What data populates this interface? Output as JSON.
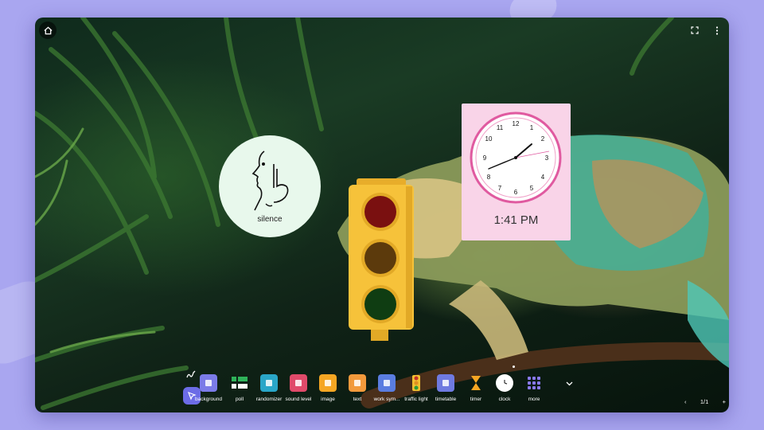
{
  "board": {
    "home_icon": "home-icon",
    "fullscreen_icon": "fullscreen-icon",
    "menu_icon": "more-vertical-icon"
  },
  "widgets": {
    "silence": {
      "label": "silence",
      "icon": "shush-face-icon"
    },
    "traffic_light": {
      "colors": [
        "#7a1010",
        "#5c3a0c",
        "#0f3d12"
      ],
      "housing": "#f6c23a"
    },
    "clock": {
      "time_text": "1:41 PM",
      "face_color": "#e05aa0",
      "card_color": "#f9d4e8"
    }
  },
  "toolbar": {
    "pointer_icon": "pointer-icon",
    "pen_icon": "pen-icon",
    "tools": [
      {
        "label": "background",
        "icon": "background-icon",
        "color": "#7b7be8"
      },
      {
        "label": "poll",
        "icon": "poll-icon",
        "color": "#2fb35a"
      },
      {
        "label": "randomizer",
        "icon": "randomizer-icon",
        "color": "#2aa6c8"
      },
      {
        "label": "sound level",
        "icon": "sound-level-icon",
        "color": "#e04a6a"
      },
      {
        "label": "image",
        "icon": "image-icon",
        "color": "#f5a623"
      },
      {
        "label": "text",
        "icon": "text-icon",
        "color": "#f29a3c"
      },
      {
        "label": "work sym...",
        "icon": "work-symbols-icon",
        "color": "#5a7de0"
      },
      {
        "label": "traffic light",
        "icon": "traffic-light-icon",
        "color": "#f0c030"
      },
      {
        "label": "timetable",
        "icon": "timetable-icon",
        "color": "#6f7ae0"
      },
      {
        "label": "timer",
        "icon": "timer-icon",
        "color": "#f5a623"
      },
      {
        "label": "clock",
        "icon": "clock-icon",
        "color": "#ffffff"
      },
      {
        "label": "more",
        "icon": "more-grid-icon",
        "color": "#8a7af0"
      }
    ],
    "expand_icon": "chevron-down-icon"
  },
  "pager": {
    "prev": "‹",
    "page": "1/1",
    "next": "+"
  }
}
